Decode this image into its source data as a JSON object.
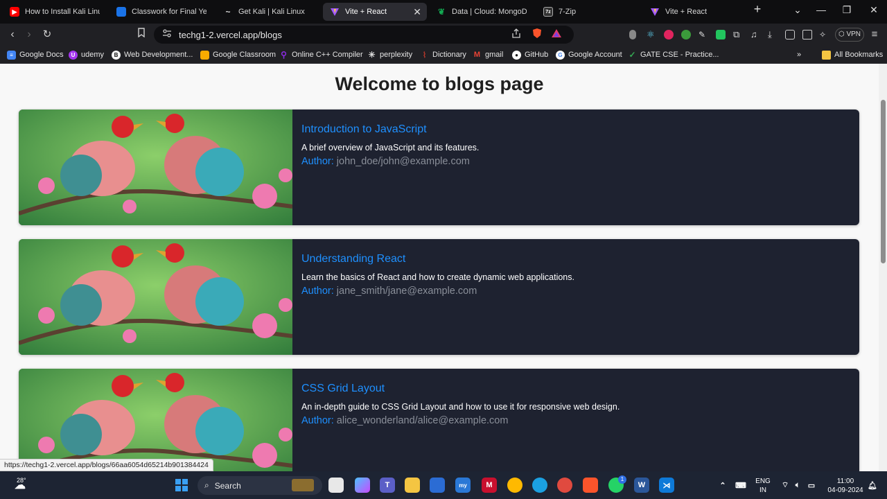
{
  "browser": {
    "tabs": [
      {
        "title": "How to Install Kali Linux in",
        "favicon": "youtube-icon",
        "color": "#ff0000"
      },
      {
        "title": "Classwork for Final Year C",
        "favicon": "classroom-icon",
        "color": "#1a73e8"
      },
      {
        "title": "Get Kali | Kali Linux",
        "favicon": "kali-icon",
        "color": "#555555"
      },
      {
        "title": "Vite + React",
        "favicon": "vite-icon",
        "color": "#a259ff",
        "active": true
      },
      {
        "title": "Data | Cloud: MongoDB C",
        "favicon": "mongodb-icon",
        "color": "#13aa52"
      },
      {
        "title": "7-Zip",
        "favicon": "7zip-icon",
        "color": "#222222"
      },
      {
        "title": "Vite + React",
        "favicon": "vite-icon",
        "color": "#a259ff"
      }
    ],
    "new_tab_label": "+",
    "address": {
      "url": "techg1-2.vercel.app/blogs"
    },
    "vpn_label": "VPN",
    "bookmarks": [
      {
        "label": "Google Docs",
        "icon": "docs-icon",
        "color": "#4285f4"
      },
      {
        "label": "udemy",
        "icon": "udemy-icon",
        "color": "#a435f0"
      },
      {
        "label": "Web Development...",
        "icon": "web-dev-icon",
        "color": "#f5f5f5"
      },
      {
        "label": "Google Classroom",
        "icon": "classroom-icon",
        "color": "#f9ab00"
      },
      {
        "label": "Online C++ Compiler",
        "icon": "compiler-icon",
        "color": "#8a2be2"
      },
      {
        "label": "perplexity",
        "icon": "perplexity-icon",
        "color": "#dddddd"
      },
      {
        "label": "Dictionary",
        "icon": "dictionary-icon",
        "color": "#c0392b"
      },
      {
        "label": "gmail",
        "icon": "gmail-icon",
        "color": "#ea4335"
      },
      {
        "label": "GitHub",
        "icon": "github-icon",
        "color": "#ffffff"
      },
      {
        "label": "Google Account",
        "icon": "google-icon",
        "color": "#ffffff"
      },
      {
        "label": "GATE CSE - Practice...",
        "icon": "check-icon",
        "color": "#34a853"
      }
    ],
    "bookmarks_overflow": "»",
    "all_bookmarks_label": "All Bookmarks",
    "status_url": "https://techg1-2.vercel.app/blogs/66aa6054d65214b901384424"
  },
  "page": {
    "title": "Welcome to blogs page",
    "author_prefix": "Author:",
    "posts": [
      {
        "title": "Introduction to JavaScript",
        "description": "A brief overview of JavaScript and its features.",
        "author": "john_doe/john@example.com"
      },
      {
        "title": "Understanding React",
        "description": "Learn the basics of React and how to create dynamic web applications.",
        "author": "jane_smith/jane@example.com"
      },
      {
        "title": "CSS Grid Layout",
        "description": "An in-depth guide to CSS Grid Layout and how to use it for responsive web design.",
        "author": "alice_wonderland/alice@example.com"
      }
    ]
  },
  "taskbar": {
    "weather": "28°",
    "search_placeholder": "Search",
    "lang_top": "ENG",
    "lang_bottom": "IN",
    "time": "11:00",
    "date": "04-09-2024",
    "whatsapp_badge": "1"
  }
}
